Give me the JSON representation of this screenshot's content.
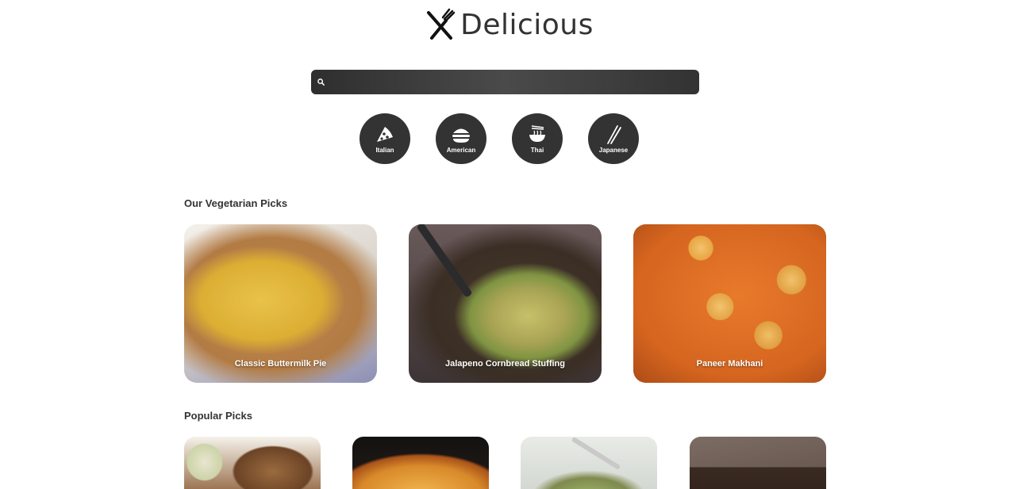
{
  "brand": {
    "name": "Delicious",
    "logo_icon": "fork-knife-icon"
  },
  "search": {
    "icon": "search-icon",
    "placeholder": "",
    "value": ""
  },
  "cuisines": [
    {
      "label": "Italian",
      "icon": "pizza-icon"
    },
    {
      "label": "American",
      "icon": "burger-icon"
    },
    {
      "label": "Thai",
      "icon": "noodle-bowl-icon"
    },
    {
      "label": "Japanese",
      "icon": "chopsticks-icon"
    }
  ],
  "vegetarian": {
    "title": "Our Vegetarian Picks",
    "items": [
      {
        "title": "Classic Buttermilk Pie"
      },
      {
        "title": "Jalapeno Cornbread Stuffing"
      },
      {
        "title": "Paneer Makhani"
      }
    ]
  },
  "popular": {
    "title": "Popular Picks",
    "items": [
      {},
      {},
      {},
      {}
    ]
  },
  "colors": {
    "accent": "#333333",
    "text": "#333333",
    "background": "#ffffff"
  }
}
